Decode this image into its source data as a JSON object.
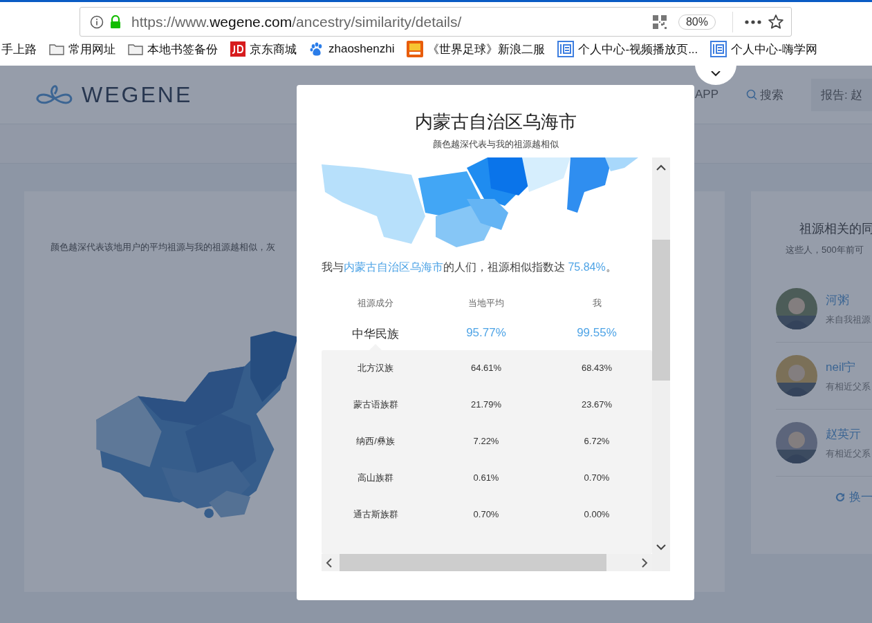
{
  "browser": {
    "url_scheme": "https://www.",
    "url_host": "wegene.com",
    "url_path": "/ancestry/similarity/details/",
    "zoom": "80%"
  },
  "bookmarks": [
    {
      "label": "手上路",
      "kind": "none"
    },
    {
      "label": "常用网址",
      "kind": "folder"
    },
    {
      "label": "本地书签备份",
      "kind": "folder"
    },
    {
      "label": "京东商城",
      "kind": "jd"
    },
    {
      "label": "zhaoshenzhi",
      "kind": "paw"
    },
    {
      "label": "《世界足球》新浪二服",
      "kind": "game"
    },
    {
      "label": "个人中心-视频播放页...",
      "kind": "tile"
    },
    {
      "label": "个人中心-嗨学网",
      "kind": "tile"
    }
  ],
  "header": {
    "logo": "WEGENE",
    "nav": [
      "APP"
    ],
    "search": "搜索",
    "report": "报告: 赵"
  },
  "left_card": {
    "note": "颜色越深代表该地用户的平均祖源与我的祖源越相似，灰"
  },
  "right_card": {
    "title": "祖源相关的同",
    "subtitle": "这些人，500年前可",
    "people": [
      {
        "name": "河粥",
        "note": "来自我祖源"
      },
      {
        "name": "neil宁",
        "note": "有相近父系"
      },
      {
        "name": "赵英亓",
        "note": "有相近父系"
      }
    ],
    "refresh": "换一"
  },
  "modal": {
    "title": "内蒙古自治区乌海市",
    "subtitle": "颜色越深代表与我的祖源越相似",
    "summary": {
      "before": "我与",
      "place": "内蒙古自治区乌海市",
      "middle": "的人们，祖源相似指数达 ",
      "value": "75.84%",
      "after": "。"
    },
    "table": {
      "columns": [
        "祖源成分",
        "当地平均",
        "我"
      ],
      "main": {
        "name": "中华民族",
        "local": "95.77%",
        "me": "99.55%"
      },
      "rows": [
        {
          "name": "北方汉族",
          "local": "64.61%",
          "me": "68.43%"
        },
        {
          "name": "蒙古语族群",
          "local": "21.79%",
          "me": "23.67%"
        },
        {
          "name": "纳西/彝族",
          "local": "7.22%",
          "me": "6.72%"
        },
        {
          "name": "高山族群",
          "local": "0.61%",
          "me": "0.70%"
        },
        {
          "name": "通古斯族群",
          "local": "0.70%",
          "me": "0.00%"
        }
      ]
    }
  }
}
